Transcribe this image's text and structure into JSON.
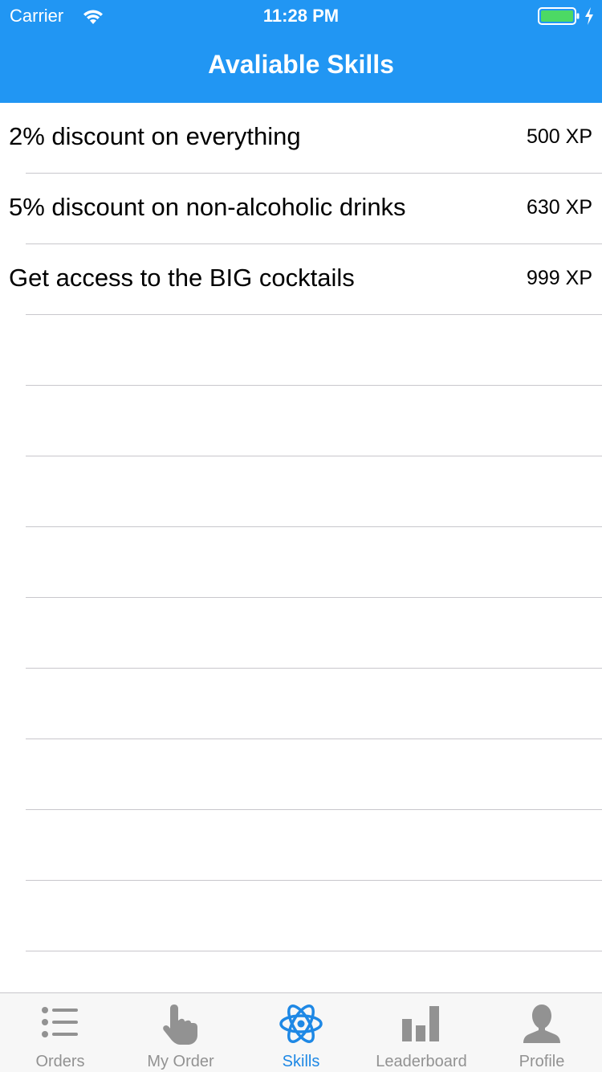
{
  "status_bar": {
    "carrier": "Carrier",
    "time": "11:28 PM"
  },
  "nav": {
    "title": "Avaliable Skills"
  },
  "skills": [
    {
      "title": "2% discount on everything",
      "xp": "500 XP"
    },
    {
      "title": "5% discount on non-alcoholic drinks",
      "xp": "630 XP"
    },
    {
      "title": "Get access to the BIG cocktails",
      "xp": "999 XP"
    }
  ],
  "tabs": [
    {
      "label": "Orders",
      "icon": "list-icon"
    },
    {
      "label": "My Order",
      "icon": "pointing-hand-icon"
    },
    {
      "label": "Skills",
      "icon": "atom-icon",
      "active": true
    },
    {
      "label": "Leaderboard",
      "icon": "bar-chart-icon"
    },
    {
      "label": "Profile",
      "icon": "person-icon"
    }
  ],
  "colors": {
    "header": "#2196F3",
    "tab_active": "#1E88E5",
    "tab_inactive": "#929292",
    "battery": "#4CD964"
  }
}
